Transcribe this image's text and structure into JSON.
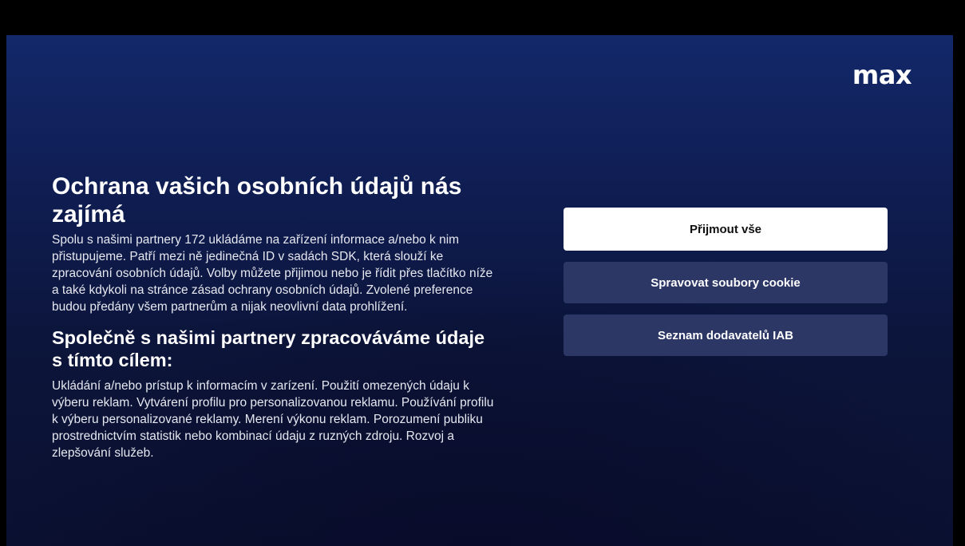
{
  "brand": {
    "logo_text": "max"
  },
  "consent": {
    "title": "Ochrana vašich osobních údajů nás zajímá",
    "body": "Spolu s našimi partnery 172 ukládáme na zařízení informace a/nebo k nim přistupujeme. Patří mezi ně jedinečná ID v sadách SDK, která slouží ke zpracování osobních údajů. Volby můžete přijimou nebo je řídit přes tlačítko níže a také kdykoli na stránce zásad ochrany osobních údajů. Zvolené preference budou předány všem partnerům a nijak neovlivní data prohlížení.",
    "purposes_title": "Společně s našimi partnery zpracováváme údaje s tímto cílem:",
    "purposes_body": "Ukládání a/nebo prístup k informacím v zarízení. Použití omezených údaju k výberu reklam. Vytvárení profilu pro personalizovanou reklamu. Používání profilu k výberu personalizované reklamy. Merení výkonu reklam. Porozumení publiku prostrednictvím statistik nebo kombinací údaju z ruzných zdroju. Rozvoj a zlepšování služeb."
  },
  "actions": {
    "accept_all": "Přijmout vše",
    "manage_cookies": "Spravovat soubory cookie",
    "vendor_list": "Seznam dodavatelů IAB"
  },
  "colors": {
    "background_top": "#13286a",
    "background_bottom": "#0a1030",
    "primary_button": "#ffffff",
    "secondary_button": "#2c3766"
  }
}
